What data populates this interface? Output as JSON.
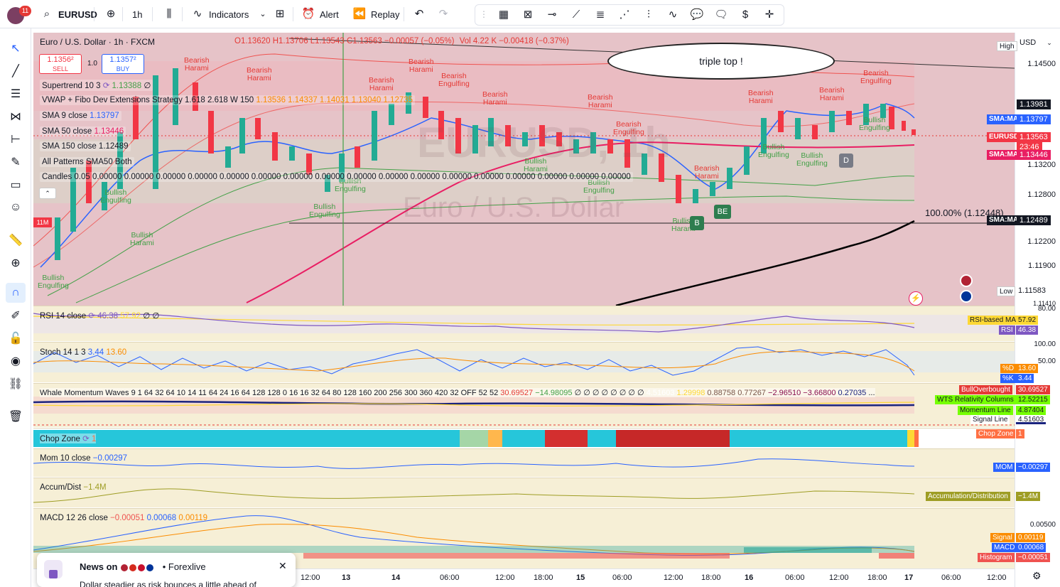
{
  "toolbar": {
    "notif_count": "11",
    "symbol": "EURUSD",
    "interval": "1h",
    "indicators": "Indicators",
    "alert": "Alert",
    "replay": "Replay"
  },
  "header": {
    "pair": "Euro / U.S. Dollar · 1h · FXCM",
    "ohlc": "O1.13620 H1.13706 L1.13543 C1.13563 −0.00057 (−0.05%)",
    "vol": "Vol 4.22 K −0.00418 (−0.37%)",
    "sell_price": "1.1356²",
    "sell_label": "SELL",
    "spread": "1.0",
    "buy_price": "1.1357²",
    "buy_label": "BUY"
  },
  "legends": {
    "supertrend": "Supertrend 10 3",
    "supertrend_val": "1.13388",
    "supertrend_zero": "∅",
    "vwap_name": "VWAP + Fibo Dev Extensions Strategy 1.618 2.618 W 150",
    "vwap_vals": "1.13536 1.14337 1.14031 1.13040 1.12735",
    "sma9": "SMA 9 close",
    "sma9_val": "1.13797",
    "sma50": "SMA 50 close",
    "sma50_val": "1.13446",
    "sma150": "SMA 150 close",
    "sma150_val": "1.12489",
    "patterns": "All Patterns SMA50 Both",
    "candles": "Candles 0.05",
    "candles_vals": "0.00000 0.00000 0.00000 0.00000 0.00000 0.00000 0.00000 0.00000 0.00000 0.00000 0.00000 0.00000 0.00000 0.00000 0.00000 0.00000 0.00000"
  },
  "price_scale": {
    "currency": "USD",
    "ticks": [
      "1.14500",
      "1.13200",
      "1.12800",
      "1.12200",
      "1.11900",
      "1.11410"
    ],
    "high_label": "High",
    "high_value": "1.13981",
    "low_label": "Low",
    "low_value": "1.11583",
    "sma9_tag": "SMA:MA",
    "sma9_value": "1.13797",
    "last_tag": "EURUSD",
    "last_value": "1.13563",
    "countdown": "23:46",
    "sma50_tag": "SMA:MA",
    "sma50_value": "1.13446",
    "sma150_tag": "SMA:MA",
    "sma150_value": "1.12489"
  },
  "chart_overlay": {
    "bubble": "triple top !",
    "fib": "100.00% (1.12448)",
    "watermark": "Euro / U.S. Dollar",
    "watermark_sym": "EURUSD, 1h",
    "left_tag": "11M",
    "badge_d": "D",
    "badge_be": "BE",
    "badge_b": "B"
  },
  "annotations": [
    {
      "t": "Bearish\nHarami",
      "k": "bear"
    },
    {
      "t": "Bearish\nHarami",
      "k": "bear"
    },
    {
      "t": "Bearish\nHarami",
      "k": "bear"
    },
    {
      "t": "Bearish\nEngulfing",
      "k": "bear"
    },
    {
      "t": "Bearish\nHarami",
      "k": "bear"
    },
    {
      "t": "Bearish\nHarami",
      "k": "bear"
    },
    {
      "t": "Bearish\nHarami",
      "k": "bear"
    },
    {
      "t": "Bearish\nEngulfing",
      "k": "bear"
    },
    {
      "t": "Bearish\nHarami",
      "k": "bear"
    },
    {
      "t": "Bearish\nHarami",
      "k": "bear"
    },
    {
      "t": "Bearish\nHarami",
      "k": "bear"
    },
    {
      "t": "Bearish\nEngulfing",
      "k": "bear"
    },
    {
      "t": "Bullish\nEngulfing",
      "k": "bull"
    },
    {
      "t": "Bullish\nHarami",
      "k": "bull"
    },
    {
      "t": "Bullish\nEngulfing",
      "k": "bull"
    },
    {
      "t": "Bullish\nEngulfing",
      "k": "bull"
    },
    {
      "t": "Bullish\nEngulfing",
      "k": "bull"
    },
    {
      "t": "Bullish\nHarami",
      "k": "bull"
    },
    {
      "t": "Bullish\nEngulfing",
      "k": "bull"
    },
    {
      "t": "Bullish\nEngulfing",
      "k": "bull"
    },
    {
      "t": "Bullish\nHarami",
      "k": "bull"
    },
    {
      "t": "Bullish\nEngulfing",
      "k": "bull"
    },
    {
      "t": "Bullish\nEngulfing",
      "k": "bull"
    }
  ],
  "rsi": {
    "legend": "RSI 14 close",
    "val1": "46.38",
    "val2": "57.92",
    "zeros": "∅ ∅",
    "tick_top": "80.00",
    "ma_label": "RSI-based MA",
    "ma_value": "57.92",
    "rsi_label": "RSI",
    "rsi_value": "46.38"
  },
  "stoch": {
    "legend": "Stoch 14 1 3",
    "k": "3.44",
    "d": "13.60",
    "tick_top": "100.00",
    "tick_mid": "50.00",
    "d_label": "%D",
    "d_value": "13.60",
    "k_label": "%K",
    "k_value": "3.44"
  },
  "whale": {
    "legend": "Whale Momentum Waves 9 1 64 32 64 10 14 11 64 24 16 64 128 128 0 16 16 32 64 80 128 160 200 256 300 360 420 32 OFF 52 52",
    "v1": "30.69527",
    "v2": "−14.98095",
    "zeros": "∅ ∅ ∅ ∅ ∅ ∅ ∅ ∅",
    "v3": "4.51603",
    "v4": "1.29998",
    "v5": "0.88758",
    "v6": "0.77267",
    "v7": "−2.96510",
    "v8": "−3.66800",
    "v9": "0.27035",
    "more": "...",
    "tags": [
      {
        "label": "BullOverbought",
        "value": "30.69527"
      },
      {
        "label": "WTS Relativity Columns",
        "value": "12.52215"
      },
      {
        "label": "Momentum Line",
        "value": "4.87404"
      },
      {
        "label": "Signal Line",
        "value": "4.51603"
      }
    ]
  },
  "chop": {
    "legend": "Chop Zone",
    "val": "1",
    "tag_label": "Chop Zone",
    "tag_value": "1"
  },
  "mom": {
    "legend": "Mom 10 close",
    "val": "−0.00297",
    "tag_label": "MOM",
    "tag_value": "−0.00297"
  },
  "accum": {
    "legend": "Accum/Dist",
    "val": "−1.4M",
    "tag_label": "Accumulation/Distribution",
    "tag_value": "−1.4M"
  },
  "macd": {
    "legend": "MACD 12 26 close",
    "v1": "−0.00051",
    "v2": "0.00068",
    "v3": "0.00119",
    "tick": "0.00500",
    "tags": [
      {
        "label": "Signal",
        "value": "0.00119"
      },
      {
        "label": "MACD",
        "value": "0.00068"
      },
      {
        "label": "Histogram",
        "value": "−0.00051"
      }
    ]
  },
  "time_axis": [
    "12:00",
    "13",
    "14",
    "06:00",
    "12:00",
    "18:00",
    "15",
    "06:00",
    "12:00",
    "18:00",
    "16",
    "06:00",
    "12:00",
    "18:00",
    "17",
    "06:00",
    "12:00"
  ],
  "news": {
    "prefix": "News on",
    "source": "• Forexlive",
    "headline": "Dollar steadier as risk bounces a little ahead of"
  }
}
